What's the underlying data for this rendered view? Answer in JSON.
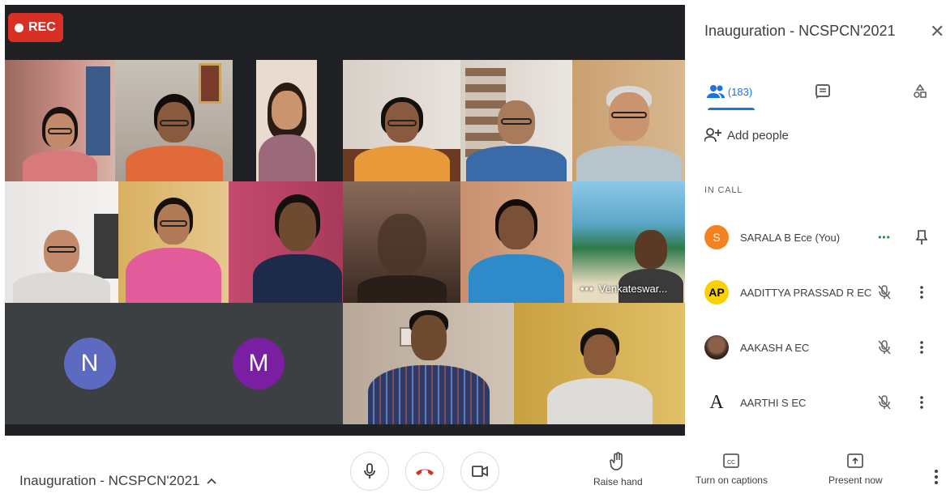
{
  "recording": {
    "label": "REC"
  },
  "panel": {
    "title": "Inauguration - NCSPCN'2021",
    "people_count": "(183)",
    "add_people": "Add people",
    "section_label": "IN CALL",
    "participants": [
      {
        "name": "SARALA B Ece (You)",
        "avatar_text": "S",
        "avatar_color": "#f4821f"
      },
      {
        "name": "AADITTYA PRASSAD R EC",
        "avatar_text": "AP",
        "avatar_color": "#fbd200"
      },
      {
        "name": "AAKASH A EC",
        "avatar_text": "",
        "avatar_color": "#6b4a3a"
      },
      {
        "name": "AARTHI S EC",
        "avatar_text": "A",
        "avatar_color": "#ffffff"
      }
    ]
  },
  "tiles": {
    "tile_name_tag": "Venkateswar...",
    "avatar_n": {
      "letter": "N",
      "color": "#5c6bc0"
    },
    "avatar_m": {
      "letter": "M",
      "color": "#7b1fa2"
    }
  },
  "bottom_bar": {
    "meeting_title": "Inauguration - NCSPCN'2021",
    "raise_hand": "Raise hand",
    "captions": "Turn on captions",
    "present": "Present now"
  },
  "colors": {
    "accent": "#1a73e8",
    "hangup": "#d93025",
    "rec": "#d93025",
    "more_dots": "#1e8e3e"
  }
}
